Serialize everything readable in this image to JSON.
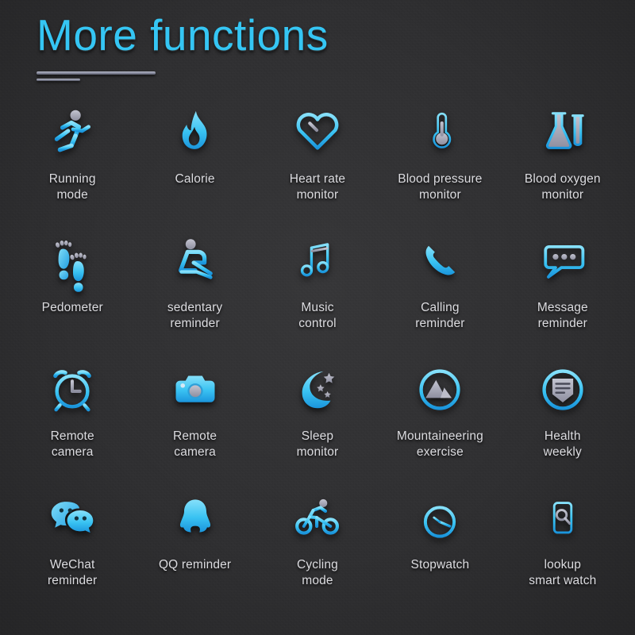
{
  "header": {
    "title": "More functions"
  },
  "theme": {
    "background": "#2e2e30",
    "accent_blue": "#35c6f4",
    "accent_blue_deep": "#1f9fe0",
    "accent_blue_light": "#7fdcf7",
    "gray_accent": "#a9aab8",
    "label_color": "#dcdce0"
  },
  "grid": {
    "columns": 5,
    "rows": 4,
    "items": [
      {
        "icon": "running-mode-icon",
        "label": "Running\nmode"
      },
      {
        "icon": "calorie-flame-icon",
        "label": "Calorie"
      },
      {
        "icon": "heart-rate-monitor-icon",
        "label": "Heart rate\nmonitor"
      },
      {
        "icon": "blood-pressure-thermometer-icon",
        "label": "Blood pressure\nmonitor"
      },
      {
        "icon": "blood-oxygen-flask-icon",
        "label": "Blood oxygen\nmonitor"
      },
      {
        "icon": "pedometer-footprints-icon",
        "label": "Pedometer"
      },
      {
        "icon": "sedentary-reminder-icon",
        "label": "sedentary\nreminder"
      },
      {
        "icon": "music-control-note-icon",
        "label": "Music\ncontrol"
      },
      {
        "icon": "calling-reminder-phone-icon",
        "label": "Calling\nreminder"
      },
      {
        "icon": "message-reminder-bubble-icon",
        "label": "Message\nreminder"
      },
      {
        "icon": "alarm-clock-icon",
        "label": "Remote\ncamera"
      },
      {
        "icon": "remote-camera-icon",
        "label": "Remote\ncamera"
      },
      {
        "icon": "sleep-monitor-moon-icon",
        "label": "Sleep\nmonitor"
      },
      {
        "icon": "mountaineering-exercise-icon",
        "label": "Mountaineering\nexercise"
      },
      {
        "icon": "health-weekly-report-icon",
        "label": "Health\nweekly"
      },
      {
        "icon": "wechat-reminder-icon",
        "label": "WeChat\nreminder"
      },
      {
        "icon": "qq-reminder-penguin-icon",
        "label": "QQ reminder"
      },
      {
        "icon": "cycling-mode-icon",
        "label": "Cycling\nmode"
      },
      {
        "icon": "stopwatch-icon",
        "label": "Stopwatch"
      },
      {
        "icon": "lookup-smart-watch-icon",
        "label": "lookup\nsmart watch"
      }
    ]
  }
}
